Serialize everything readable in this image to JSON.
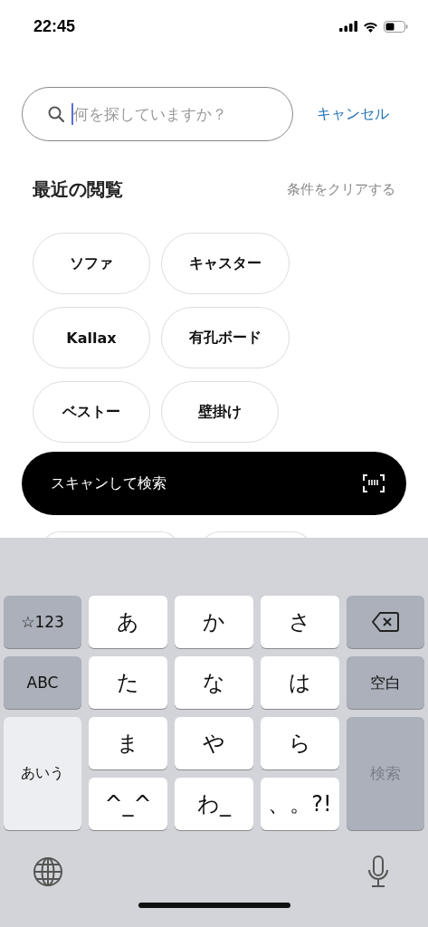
{
  "status_bar": {
    "time": "22:45"
  },
  "search": {
    "placeholder": "何を探していますか？",
    "focused": true
  },
  "cancel": "キャンセル",
  "recent": {
    "title": "最近の閲覧",
    "clear": "条件をクリアする",
    "chips": [
      "ソファ",
      "キャスター",
      "Kallax",
      "有孔ボード",
      "ベストー",
      "壁掛け"
    ]
  },
  "scan_button": {
    "label": "スキャンして検索"
  },
  "keyboard": {
    "keys": [
      {
        "kind": "function",
        "label": "☆123"
      },
      {
        "kind": "letter",
        "label": "あ"
      },
      {
        "kind": "letter",
        "label": "か"
      },
      {
        "kind": "letter",
        "label": "さ"
      },
      {
        "kind": "delete"
      },
      {
        "kind": "function",
        "label": "ABC"
      },
      {
        "kind": "letter",
        "label": "た"
      },
      {
        "kind": "letter",
        "label": "な"
      },
      {
        "kind": "letter",
        "label": "は"
      },
      {
        "kind": "function",
        "label": "空白"
      },
      {
        "kind": "mode",
        "label": "あいう"
      },
      {
        "kind": "letter",
        "label": "ま"
      },
      {
        "kind": "letter",
        "label": "や"
      },
      {
        "kind": "letter",
        "label": "ら"
      },
      {
        "kind": "action",
        "label": "検索",
        "disabled": true
      },
      {
        "kind": "letter",
        "label": "^_^"
      },
      {
        "kind": "letter",
        "label": "わ_"
      },
      {
        "kind": "letter",
        "label": "、。?!"
      }
    ]
  }
}
